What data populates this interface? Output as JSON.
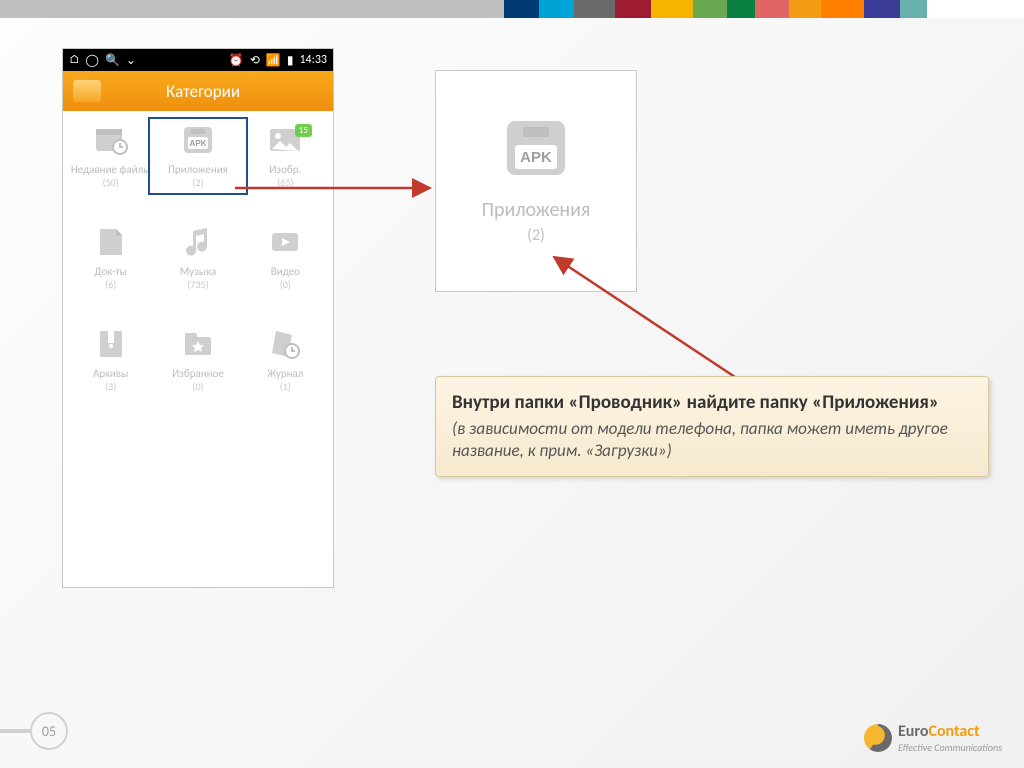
{
  "stripe_colors": [
    "#003b71",
    "#00a3d6",
    "#6a6a6a",
    "#9e1b32",
    "#f4b400",
    "#6aa84f",
    "#0b8043",
    "#e06666",
    "#f39c12",
    "#ff7f00",
    "#3b3b98",
    "#68b0ab"
  ],
  "statusbar": {
    "left_icons": [
      "home-icon",
      "circle-icon",
      "search-icon",
      "chevron-down-icon"
    ],
    "right_icons": [
      "alarm-icon",
      "sync-icon",
      "signal-icon",
      "battery-icon"
    ],
    "time": "14:33"
  },
  "appbar": {
    "title": "Категории"
  },
  "categories": [
    {
      "name": "Недавние файлы",
      "count": "(50)",
      "icon": "recent"
    },
    {
      "name": "Приложения",
      "count": "(2)",
      "icon": "apk",
      "selected": true
    },
    {
      "name": "Изобр.",
      "count": "(65)",
      "icon": "image",
      "badge": "15"
    },
    {
      "name": "Док-ты",
      "count": "(6)",
      "icon": "doc"
    },
    {
      "name": "Музыка",
      "count": "(735)",
      "icon": "music"
    },
    {
      "name": "Видео",
      "count": "(0)",
      "icon": "video"
    },
    {
      "name": "Архивы",
      "count": "(3)",
      "icon": "archive"
    },
    {
      "name": "Избранное",
      "count": "(0)",
      "icon": "fav"
    },
    {
      "name": "Журнал",
      "count": "(1)",
      "icon": "log"
    }
  ],
  "zoom": {
    "label": "Приложения",
    "count": "(2)"
  },
  "note": {
    "line1": "Внутри папки «Проводник» найдите папку «Приложения»",
    "line2": "(в зависимости от модели телефона, папка может иметь другое название, к прим. «Загрузки»)"
  },
  "page": "05",
  "brand": {
    "part1": "Euro",
    "part2": "Contact",
    "tag": "Effective Communications"
  }
}
